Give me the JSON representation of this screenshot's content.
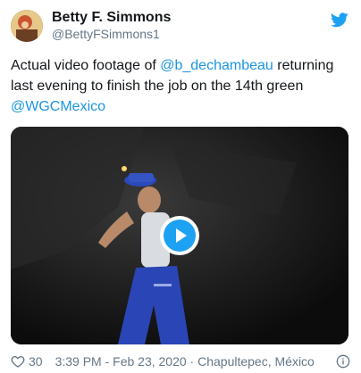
{
  "author": {
    "display_name": "Betty F. Simmons",
    "handle": "@BettyFSimmons1"
  },
  "tweet": {
    "text_part1": "Actual video footage of ",
    "mention1": "@b_dechambeau",
    "text_part2": " returning last evening to finish the job on the 14th green ",
    "mention2": "@WGCMexico"
  },
  "footer": {
    "like_count": "30",
    "meta": "3:39 PM - Feb 23, 2020 · Chapultepec, México"
  },
  "icons": {
    "brand": "twitter-bird-icon",
    "like": "heart-icon",
    "info": "info-icon",
    "play": "play-icon"
  },
  "colors": {
    "link": "#1b95e0",
    "brand": "#1da1f2",
    "muted": "#657786",
    "text": "#14171a"
  }
}
